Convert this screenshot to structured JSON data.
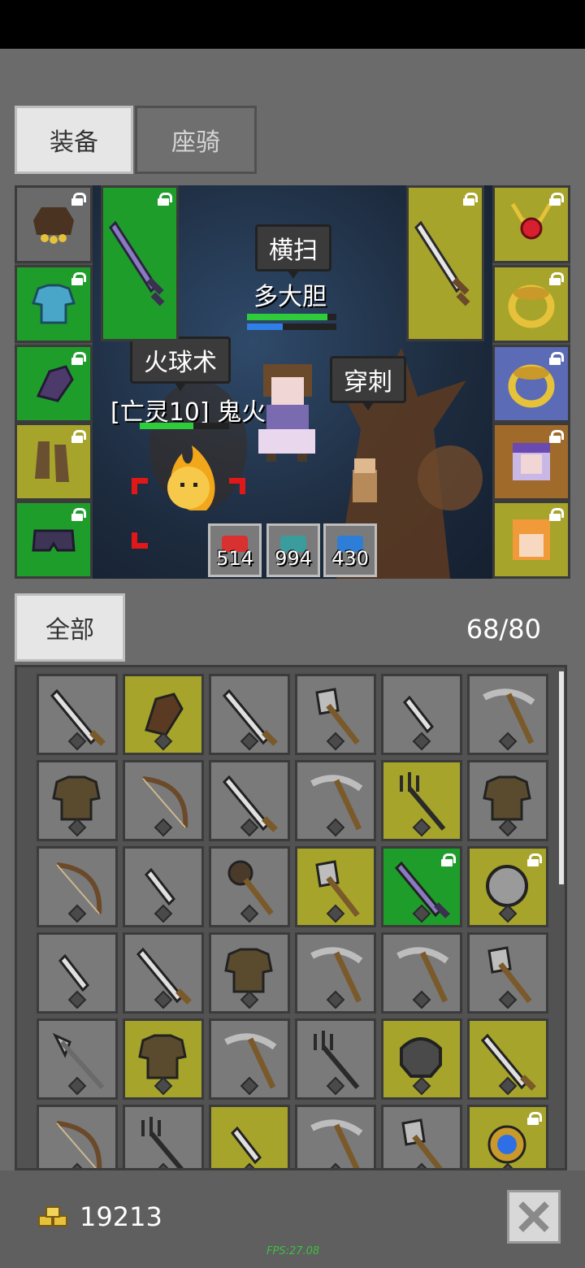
{
  "tabs": {
    "equip": "装备",
    "mount": "座骑"
  },
  "scene": {
    "skill_top": "横扫",
    "player_name": "多大胆",
    "skill_left": "火球术",
    "enemy_name": "[亡灵10] 鬼火",
    "skill_right": "穿刺",
    "player_hp_pct": 0.9,
    "enemy_hp_pct": 0.6
  },
  "potions": [
    {
      "name": "red-potion",
      "count": "514",
      "color": "#d93030"
    },
    {
      "name": "teal-potion",
      "count": "994",
      "color": "#3a9c9c"
    },
    {
      "name": "blue-potion",
      "count": "430",
      "color": "#2e7dd6"
    }
  ],
  "inventory": {
    "filter_tab": "全部",
    "capacity": "68/80"
  },
  "footer": {
    "gold": "19213",
    "fps": "FPS:27.08"
  },
  "grid_items": [
    [
      "sword",
      "gray"
    ],
    [
      "gloves",
      "yellow"
    ],
    [
      "sword",
      "gray"
    ],
    [
      "axe",
      "gray"
    ],
    [
      "dagger",
      "gray"
    ],
    [
      "pickaxe",
      "gray"
    ],
    [
      "armor",
      "gray"
    ],
    [
      "bow",
      "gray"
    ],
    [
      "sword",
      "gray"
    ],
    [
      "pickaxe",
      "gray"
    ],
    [
      "trident",
      "yellow"
    ],
    [
      "armor",
      "gray"
    ],
    [
      "bow",
      "gray"
    ],
    [
      "dagger",
      "gray"
    ],
    [
      "mace",
      "gray"
    ],
    [
      "axe",
      "yellow"
    ],
    [
      "sword-purple",
      "green"
    ],
    [
      "shield",
      "yellow"
    ],
    [
      "dagger",
      "gray"
    ],
    [
      "sword",
      "gray"
    ],
    [
      "armor",
      "gray"
    ],
    [
      "pickaxe",
      "gray"
    ],
    [
      "pickaxe",
      "gray"
    ],
    [
      "axe",
      "gray"
    ],
    [
      "halberd",
      "gray"
    ],
    [
      "armor",
      "yellow"
    ],
    [
      "pickaxe",
      "gray"
    ],
    [
      "trident",
      "gray"
    ],
    [
      "helmet",
      "yellow"
    ],
    [
      "sword",
      "yellow"
    ],
    [
      "bow",
      "gray"
    ],
    [
      "trident",
      "gray"
    ],
    [
      "dagger",
      "yellow"
    ],
    [
      "pickaxe",
      "gray"
    ],
    [
      "axe",
      "gray"
    ],
    [
      "amulet",
      "yellow"
    ]
  ]
}
